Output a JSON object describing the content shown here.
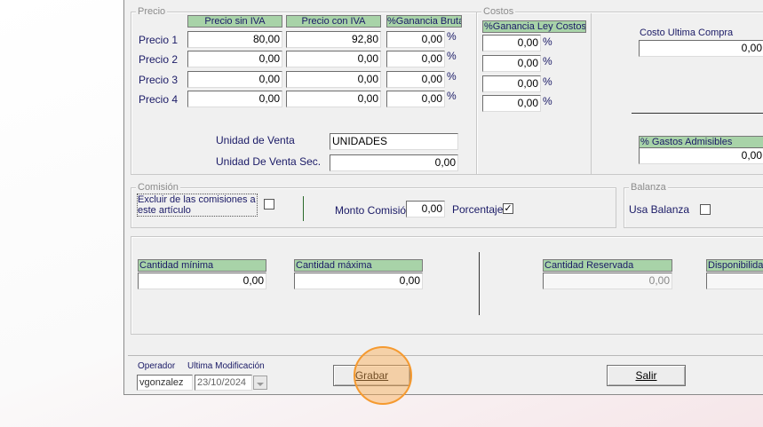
{
  "precio": {
    "legend": "Precio",
    "headers": [
      "Precio sin IVA",
      "Precio con IVA",
      "%Ganancia Bruta"
    ],
    "rows": [
      {
        "label": "Precio 1",
        "sin_iva": "80,00",
        "con_iva": "92,80",
        "ganancia": "0,00"
      },
      {
        "label": "Precio 2",
        "sin_iva": "0,00",
        "con_iva": "0,00",
        "ganancia": "0,00"
      },
      {
        "label": "Precio 3",
        "sin_iva": "0,00",
        "con_iva": "0,00",
        "ganancia": "0,00"
      },
      {
        "label": "Precio 4",
        "sin_iva": "0,00",
        "con_iva": "0,00",
        "ganancia": "0,00"
      }
    ],
    "percent_symbol": "%",
    "unidad_venta_label": "Unidad de Venta",
    "unidad_venta_value": "UNIDADES",
    "unidad_venta_sec_label": "Unidad De Venta Sec.",
    "unidad_venta_sec_value": "0,00"
  },
  "costos": {
    "legend": "Costos",
    "header": "%Ganancia Ley Costos",
    "values": [
      "0,00",
      "0,00",
      "0,00",
      "0,00"
    ],
    "costo_ultima_label": "Costo Ultima Compra",
    "costo_ultima_value": "0,00",
    "gastos_label": "% Gastos Admisibles",
    "gastos_value": "0,00"
  },
  "comision": {
    "legend": "Comisión",
    "excluir_label": "Excluir de las  comisiones a este artículo",
    "excluir_checked": "",
    "monto_label": "Monto Comisión",
    "monto_value": "0,00",
    "porcentaje_label": "Porcentaje",
    "porcentaje_checked": "✓"
  },
  "balanza": {
    "legend": "Balanza",
    "usa_label": "Usa Balanza",
    "usa_checked": ""
  },
  "stock": {
    "minima_label": "Cantidad mínima",
    "minima_value": "0,00",
    "maxima_label": "Cantidad máxima",
    "maxima_value": "0,00",
    "reservada_label": "Cantidad Reservada",
    "reservada_value": "0,00",
    "disponibilidad_label": "Disponibilidad",
    "disponibilidad_value": ""
  },
  "footer": {
    "operador_label": "Operador",
    "operador_value": "vgonzalez",
    "modificacion_label": "Ultima Modificación",
    "modificacion_value": "23/10/2024",
    "grabar_label": "Grabar",
    "salir_label": "Salir"
  }
}
